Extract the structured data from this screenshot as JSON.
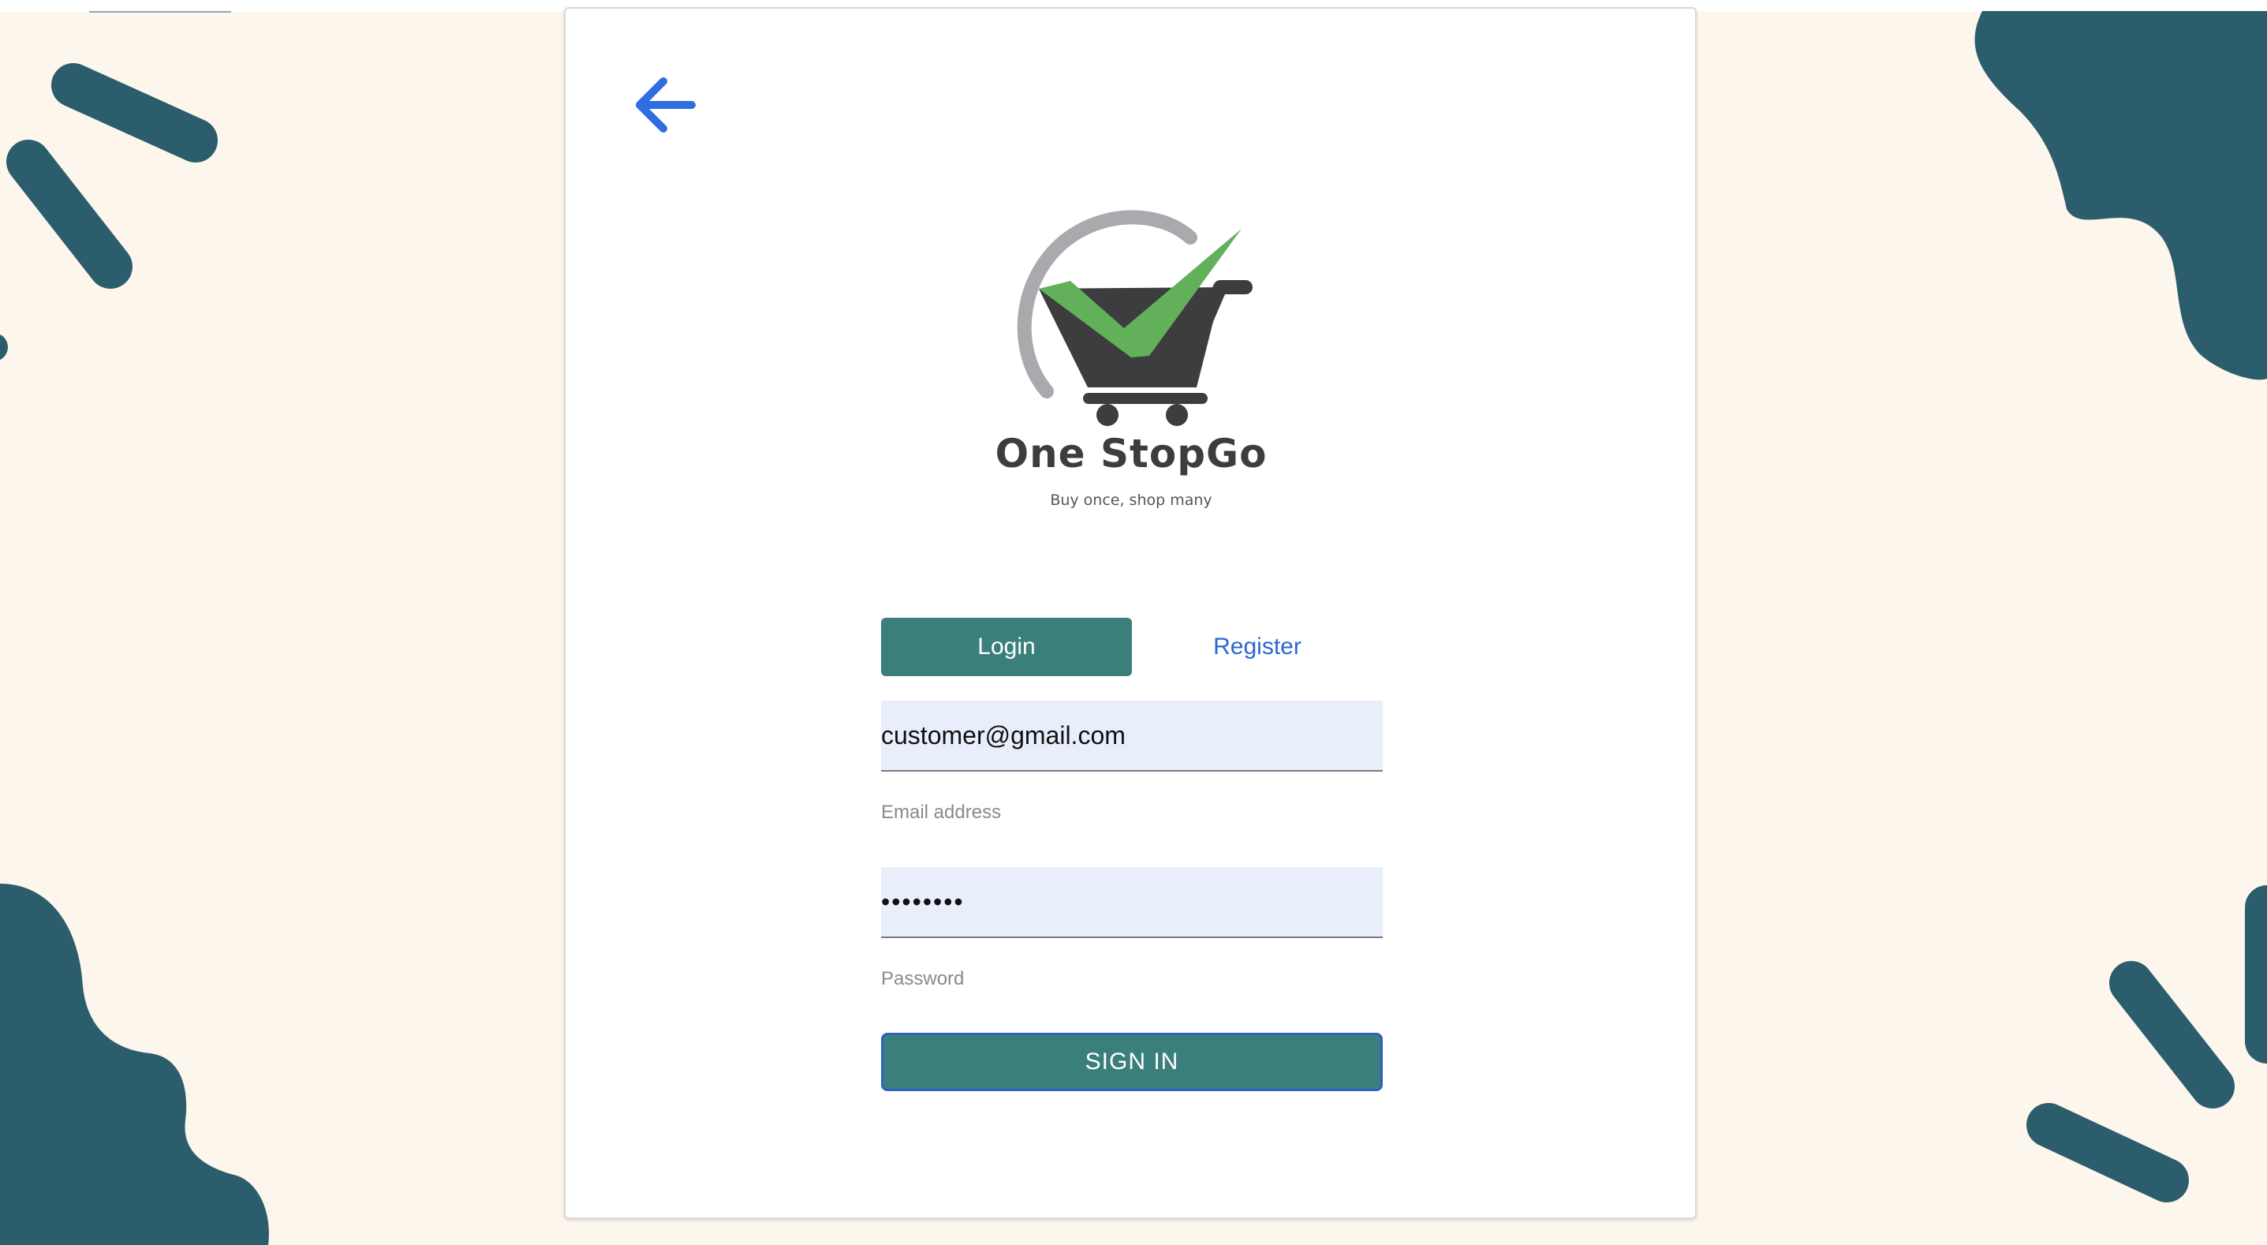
{
  "colors": {
    "page_background": "#fdf6ec",
    "decoration": "#2b5d6d",
    "primary": "#3a7f7b",
    "link": "#2a66d8",
    "back_arrow": "#2f6ee0",
    "field_background": "#e8effb",
    "logo_check": "#62b059",
    "logo_cart": "#3d3d3f",
    "logo_arc": "#a9aaad"
  },
  "icons": {
    "back": "arrow-left-icon",
    "logo": "cart-checkmark-logo"
  },
  "brand": {
    "name": "One StopGo",
    "tagline": "Buy once, shop many"
  },
  "tabs": {
    "login_label": "Login",
    "register_label": "Register",
    "active": "Login"
  },
  "form": {
    "email": {
      "value": "customer@gmail.com",
      "label": "Email address"
    },
    "password": {
      "value": "password",
      "label": "Password"
    },
    "submit_label": "SIGN IN"
  }
}
